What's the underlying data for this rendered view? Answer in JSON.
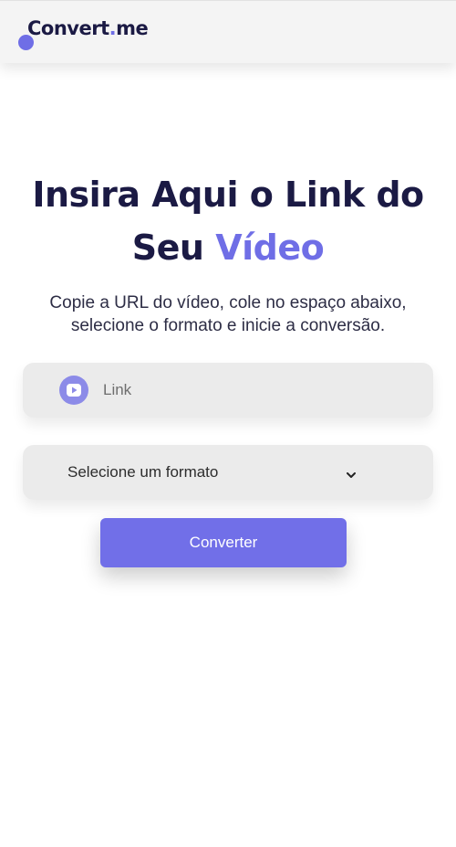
{
  "header": {
    "logo": {
      "part1": "Convert",
      "separator": ".",
      "part2": "me"
    }
  },
  "hero": {
    "title_line1": "Insira Aqui o Link do",
    "title_line2_prefix": "Seu ",
    "title_line2_accent": "Vídeo",
    "subtitle": "Copie a URL do vídeo, cole no espaço abaixo, selecione o formato e inicie a conversão."
  },
  "form": {
    "link_placeholder": "Link",
    "link_icon": "youtube-icon",
    "format_selected": "Selecione um formato",
    "format_icon": "chevron-down-icon",
    "convert_label": "Converter"
  },
  "colors": {
    "accent": "#6f6ee6",
    "dark_text": "#1b1a44",
    "field_bg": "#ebebeb",
    "button_bg": "#716fe8",
    "header_bg": "#f4f4f4"
  }
}
